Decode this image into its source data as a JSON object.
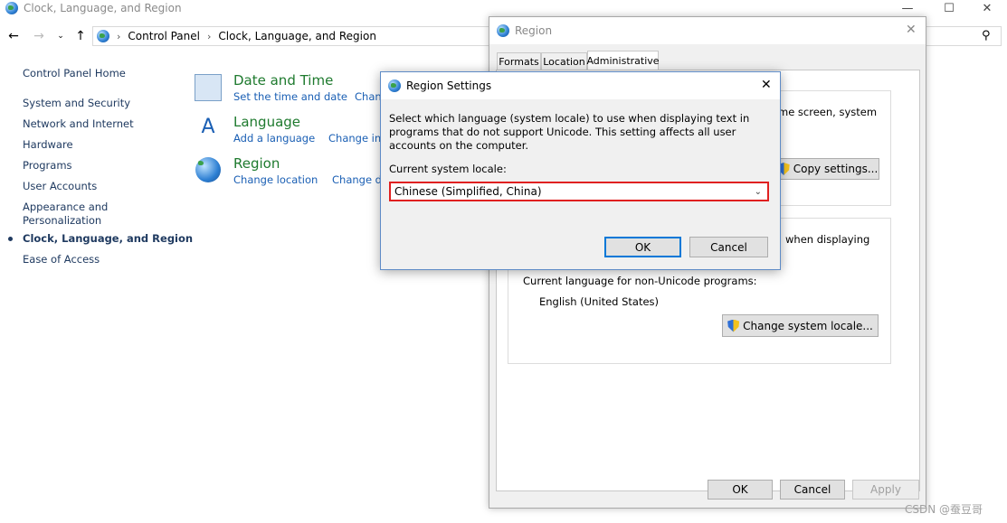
{
  "control_panel": {
    "window_title": "Clock, Language, and Region",
    "breadcrumb": [
      "Control Panel",
      "Clock, Language, and Region"
    ],
    "sidebar": {
      "home": "Control Panel Home",
      "items": [
        "System and Security",
        "Network and Internet",
        "Hardware",
        "Programs",
        "User Accounts",
        "Appearance and Personalization",
        "Clock, Language, and Region",
        "Ease of Access"
      ]
    },
    "categories": [
      {
        "title": "Date and Time",
        "links": [
          "Set the time and date",
          "Chan"
        ]
      },
      {
        "title": "Language",
        "links": [
          "Add a language",
          "Change inp"
        ]
      },
      {
        "title": "Region",
        "links": [
          "Change location",
          "Change da"
        ]
      }
    ]
  },
  "region_window": {
    "title": "Region",
    "tabs": [
      "Formats",
      "Location",
      "Administrative"
    ],
    "welcome_fragment": "me screen, system",
    "copy_settings_button": "Copy settings...",
    "unicode_fragment": "when displaying",
    "current_lang_label": "Current language for non-Unicode programs:",
    "current_lang_value": "English (United States)",
    "change_locale_button": "Change system locale...",
    "ok": "OK",
    "cancel": "Cancel",
    "apply": "Apply"
  },
  "region_settings_dialog": {
    "title": "Region Settings",
    "description": "Select which language (system locale) to use when displaying text in programs that do not support Unicode. This setting affects all user accounts on the computer.",
    "locale_label": "Current system locale:",
    "locale_value": "Chinese (Simplified, China)",
    "ok": "OK",
    "cancel": "Cancel"
  },
  "watermark": "CSDN @蚕豆哥",
  "colors": {
    "link": "#1a5fb4",
    "category_title": "#1e7a2e",
    "highlight_border": "#e02020",
    "focus": "#0078d7"
  }
}
